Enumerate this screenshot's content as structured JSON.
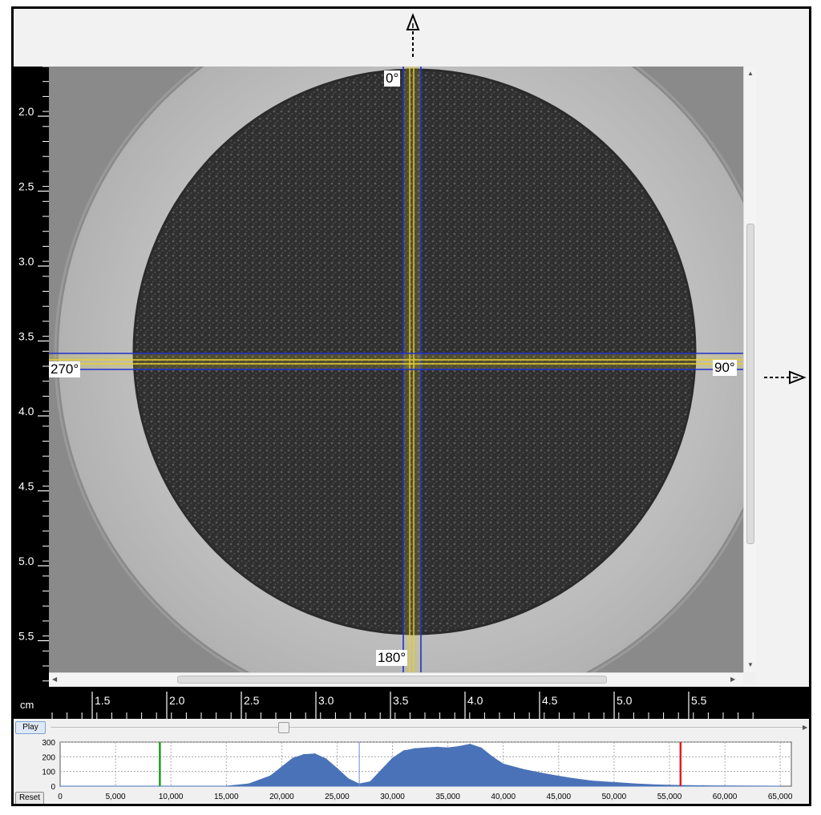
{
  "viewer": {
    "angles": {
      "top": "0°",
      "right": "90°",
      "bottom": "180°",
      "left": "270°"
    },
    "view_arrow_top": "up-view-arrow",
    "view_arrow_right": "right-view-arrow"
  },
  "left_ruler": {
    "labels": [
      "2.0",
      "2.5",
      "3.0",
      "3.5",
      "4.0",
      "4.5",
      "5.0",
      "5.5"
    ]
  },
  "bottom_ruler": {
    "unit": "cm",
    "labels": [
      "1.5",
      "2.0",
      "2.5",
      "3.0",
      "3.5",
      "4.0",
      "4.5",
      "5.0",
      "5.5"
    ]
  },
  "controls": {
    "play_label": "Play",
    "reset_label": "Reset",
    "slider_position": 0.31
  },
  "histogram": {
    "y_ticks": [
      "300",
      "200",
      "100",
      "0"
    ],
    "x_ticks": [
      "0",
      "5,000",
      "10,000",
      "15,000",
      "20,000",
      "25,000",
      "30,000",
      "35,000",
      "40,000",
      "45,000",
      "50,000",
      "55,000",
      "60,000",
      "65,000"
    ],
    "markers": {
      "green": 9000,
      "blue": 27000,
      "red": 56000
    },
    "colors": {
      "fill": "#4a72b8",
      "green": "#1e9b1e",
      "red": "#e01e1e",
      "blue": "#6a8ad0"
    }
  },
  "chart_data": {
    "type": "area",
    "x": [
      0,
      15000,
      17000,
      19000,
      20000,
      21000,
      22000,
      23000,
      24000,
      25000,
      26000,
      27000,
      28000,
      29000,
      30000,
      31000,
      32000,
      33000,
      34000,
      35000,
      36000,
      37000,
      38000,
      39000,
      40000,
      42000,
      44000,
      46000,
      48000,
      50000,
      52000,
      54000,
      56000,
      58000,
      65000
    ],
    "values": [
      0,
      0,
      15,
      70,
      130,
      190,
      215,
      220,
      185,
      120,
      50,
      15,
      30,
      110,
      190,
      240,
      255,
      260,
      265,
      260,
      270,
      285,
      260,
      200,
      150,
      110,
      80,
      55,
      35,
      25,
      15,
      8,
      5,
      3,
      0
    ],
    "xlim": [
      0,
      66000
    ],
    "ylim": [
      0,
      300
    ],
    "grid": true
  }
}
